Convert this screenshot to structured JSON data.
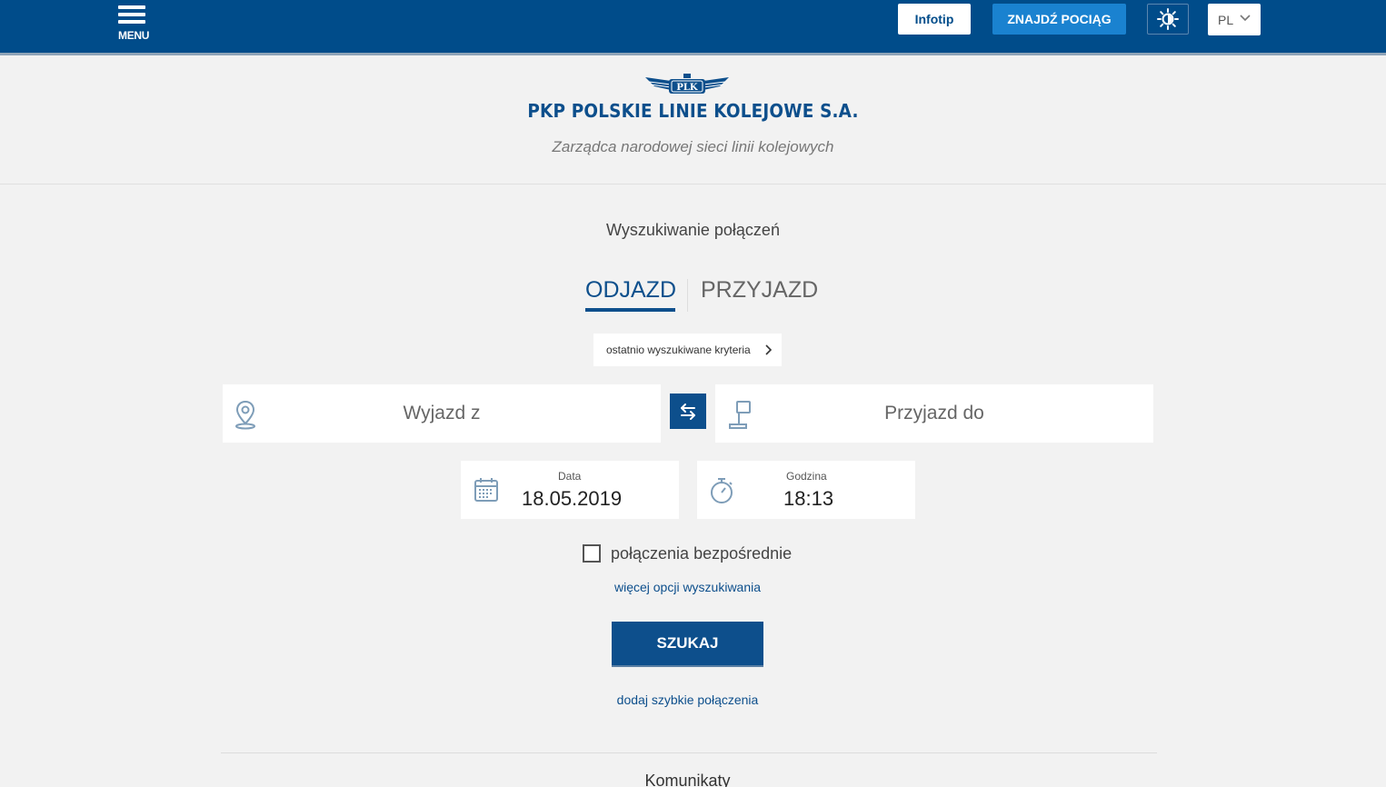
{
  "header": {
    "menu_label": "MENU",
    "infotip_label": "Infotip",
    "find_train_label": "ZNAJDŹ POCIĄG",
    "contrast_icon": "sun-icon",
    "language": "PL"
  },
  "logo": {
    "emblem_text": "PLK",
    "company": "PKP POLSKIE LINIE KOLEJOWE S.A.",
    "tagline": "Zarządca narodowej sieci linii kolejowych"
  },
  "search": {
    "title": "Wyszukiwanie połączeń",
    "tabs": [
      {
        "label": "ODJAZD",
        "active": true
      },
      {
        "label": "PRZYJAZD",
        "active": false
      }
    ],
    "recent_label": "ostatnio wyszukiwane kryteria",
    "from_placeholder": "Wyjazd z",
    "to_placeholder": "Przyjazd do",
    "date_label": "Data",
    "date_value": "18.05.2019",
    "time_label": "Godzina",
    "time_value": "18:13",
    "direct_label": "połączenia bezpośrednie",
    "direct_checked": false,
    "more_options": "więcej opcji wyszukiwania",
    "search_button": "SZUKAJ",
    "add_fast": "dodaj szybkie połączenia"
  },
  "announcements": {
    "title": "Komunikaty"
  },
  "colors": {
    "brand_blue": "#004c8a",
    "accent_blue": "#1a82d0",
    "background": "#f2f2f2"
  }
}
